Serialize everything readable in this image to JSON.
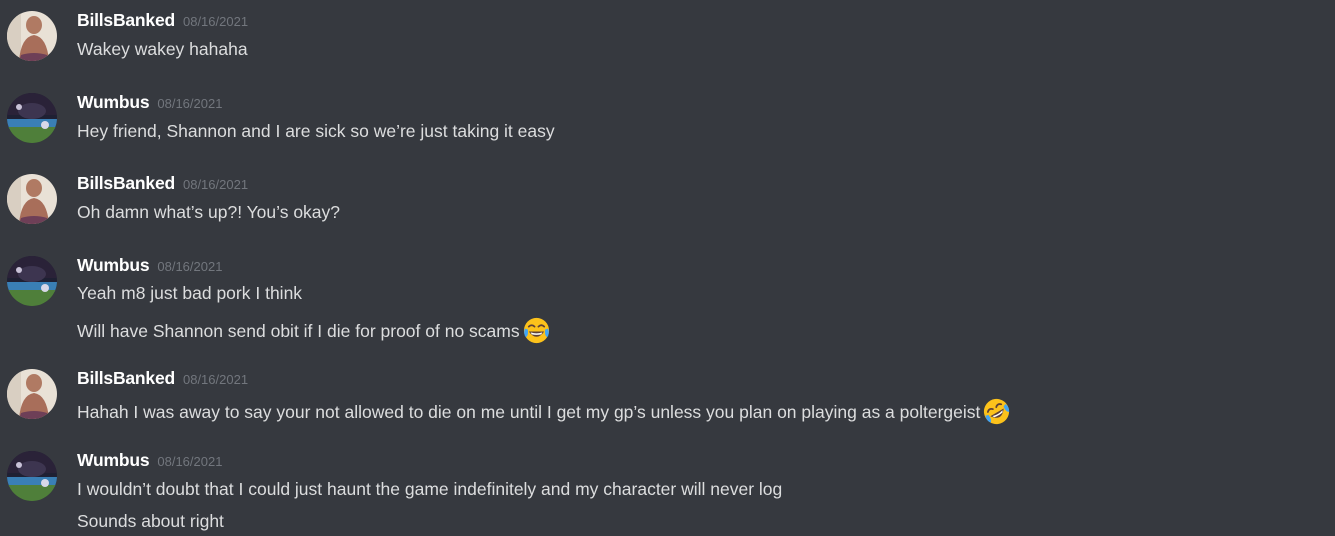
{
  "colors": {
    "background": "#36393f",
    "username": "#ffffff",
    "timestamp": "#72767d",
    "message_text": "#dcddde"
  },
  "messages": [
    {
      "username": "BillsBanked",
      "timestamp": "08/16/2021",
      "avatar": "user-avatar-billsbanked",
      "lines": [
        {
          "text": "Wakey wakey hahaha",
          "emoji": ""
        }
      ]
    },
    {
      "username": "Wumbus",
      "timestamp": "08/16/2021",
      "avatar": "user-avatar-wumbus",
      "lines": [
        {
          "text": "Hey friend, Shannon and I are sick so we’re just taking it easy",
          "emoji": ""
        }
      ]
    },
    {
      "username": "BillsBanked",
      "timestamp": "08/16/2021",
      "avatar": "user-avatar-billsbanked",
      "lines": [
        {
          "text": "Oh damn what’s up?! You’s okay?",
          "emoji": ""
        }
      ]
    },
    {
      "username": "Wumbus",
      "timestamp": "08/16/2021",
      "avatar": "user-avatar-wumbus",
      "lines": [
        {
          "text": "Yeah m8 just bad pork I think",
          "emoji": ""
        },
        {
          "text": "Will have Shannon send obit if I die for proof of no scams",
          "emoji": "face-with-tears-of-joy"
        }
      ]
    },
    {
      "username": "BillsBanked",
      "timestamp": "08/16/2021",
      "avatar": "user-avatar-billsbanked",
      "lines": [
        {
          "text": "Hahah I was away to say your not allowed to die on me until I get my gp’s unless you plan on playing as a poltergeist",
          "emoji": "rolling-on-floor-laughing"
        }
      ]
    },
    {
      "username": "Wumbus",
      "timestamp": "08/16/2021",
      "avatar": "user-avatar-wumbus",
      "lines": [
        {
          "text": "I wouldn’t doubt that I could just haunt the game indefinitely and my character will never log",
          "emoji": ""
        },
        {
          "text": "Sounds about right",
          "emoji": ""
        }
      ]
    }
  ]
}
